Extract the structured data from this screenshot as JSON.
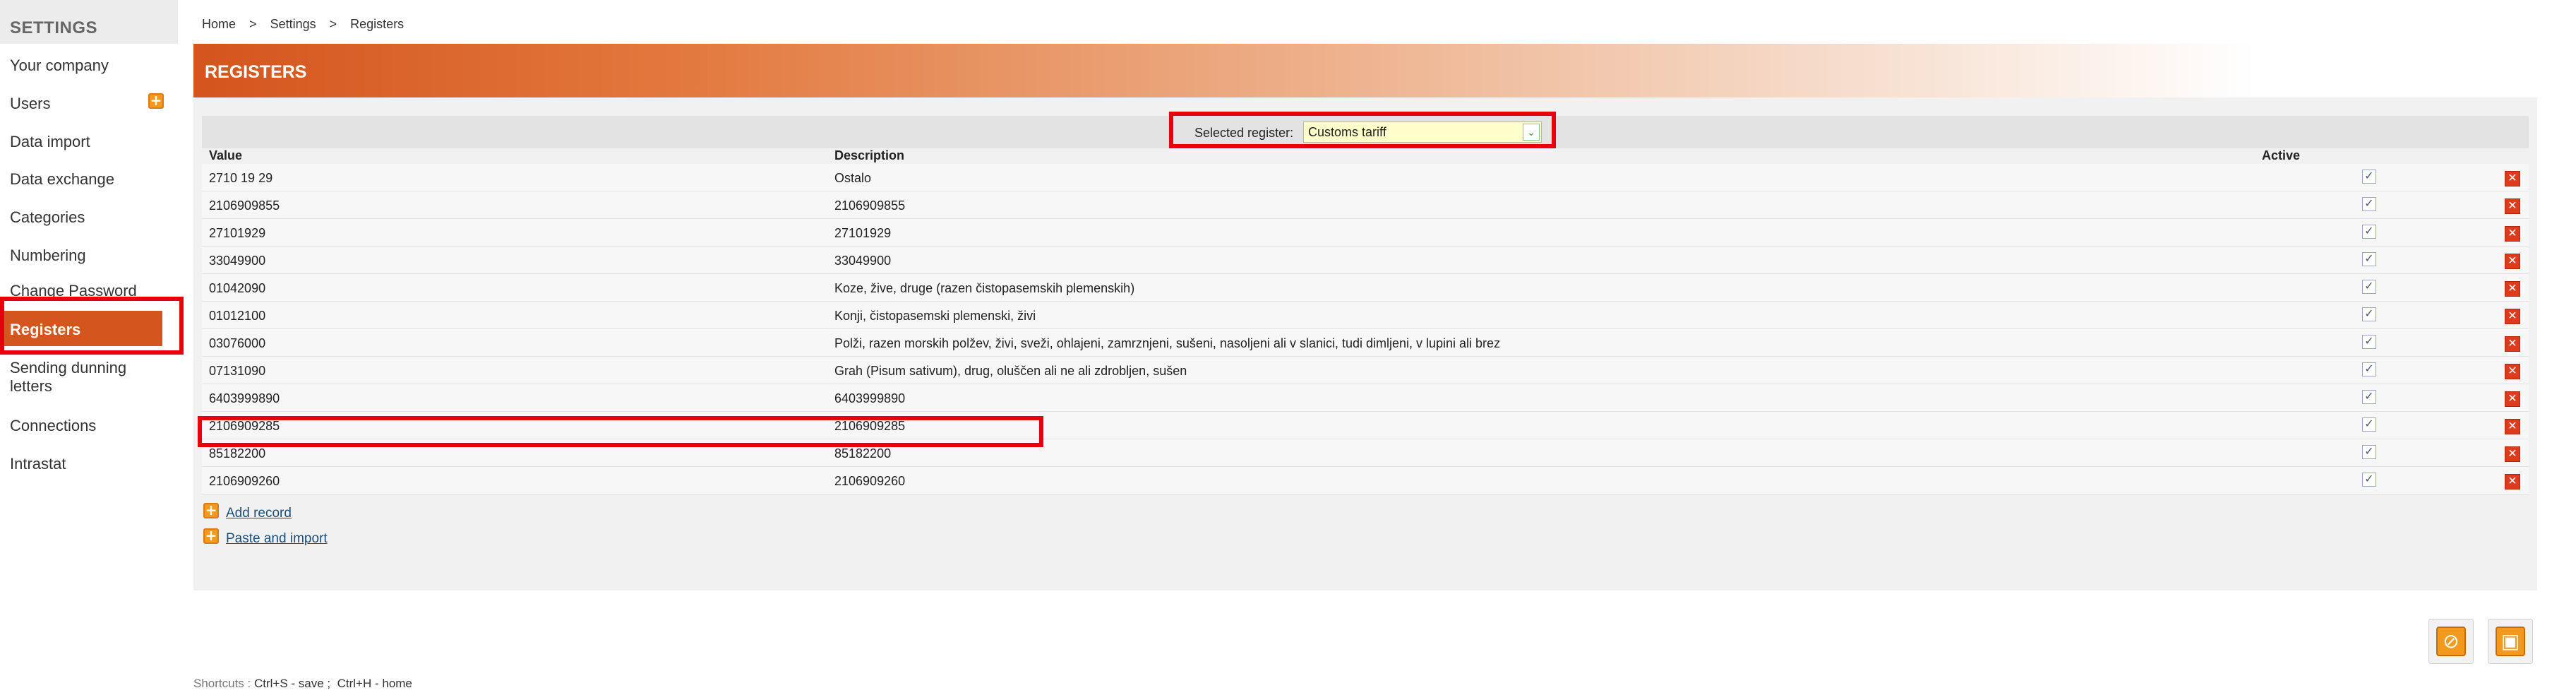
{
  "sidebar": {
    "title": "SETTINGS",
    "items": [
      {
        "label": "Your company"
      },
      {
        "label": "Users"
      },
      {
        "label": "Data import"
      },
      {
        "label": "Data exchange"
      },
      {
        "label": "Categories"
      },
      {
        "label": "Numbering"
      },
      {
        "label": "Change Password"
      },
      {
        "label": "Registers"
      },
      {
        "label": "Sending dunning letters"
      },
      {
        "label": "Connections"
      },
      {
        "label": "Intrastat"
      }
    ],
    "users_add_icon": "plus-icon"
  },
  "breadcrumb": {
    "home": "Home",
    "sep": ">",
    "settings": "Settings",
    "current": "Registers"
  },
  "header": {
    "title": "REGISTERS"
  },
  "selector": {
    "label": "Selected register:",
    "value": "Customs tariff"
  },
  "table": {
    "columns": {
      "value": "Value",
      "description": "Description",
      "active": "Active"
    },
    "rows": [
      {
        "value": "2710 19 29",
        "description": "Ostalo",
        "active": true
      },
      {
        "value": "2106909855",
        "description": "2106909855",
        "active": true
      },
      {
        "value": "27101929",
        "description": "27101929",
        "active": true
      },
      {
        "value": "33049900",
        "description": "33049900",
        "active": true
      },
      {
        "value": "01042090",
        "description": "Koze, žive, druge (razen čistopasemskih plemenskih)",
        "active": true
      },
      {
        "value": "01012100",
        "description": "Konji, čistopasemski plemenski, živi",
        "active": true
      },
      {
        "value": "03076000",
        "description": "Polži, razen morskih polžev, živi, sveži, ohlajeni, zamrznjeni, sušeni, nasoljeni ali v slanici, tudi dimljeni, v lupini ali brez",
        "active": true
      },
      {
        "value": "07131090",
        "description": "Grah (Pisum sativum), drug, oluščen ali ne ali zdrobljen, sušen",
        "active": true
      },
      {
        "value": "6403999890",
        "description": "6403999890",
        "active": true
      },
      {
        "value": "2106909285",
        "description": "2106909285",
        "active": true
      },
      {
        "value": "85182200",
        "description": "85182200",
        "active": true
      },
      {
        "value": "2106909260",
        "description": "2106909260",
        "active": true
      }
    ]
  },
  "actions": {
    "add_record": "Add record",
    "paste_import": "Paste and import"
  },
  "shortcuts": {
    "prefix": "Shortcuts : ",
    "save": "Ctrl+S - save ;",
    "home": "Ctrl+H - home"
  },
  "colors": {
    "accent": "#d4551e",
    "highlight": "#e8000b",
    "delete": "#e03a1c"
  }
}
